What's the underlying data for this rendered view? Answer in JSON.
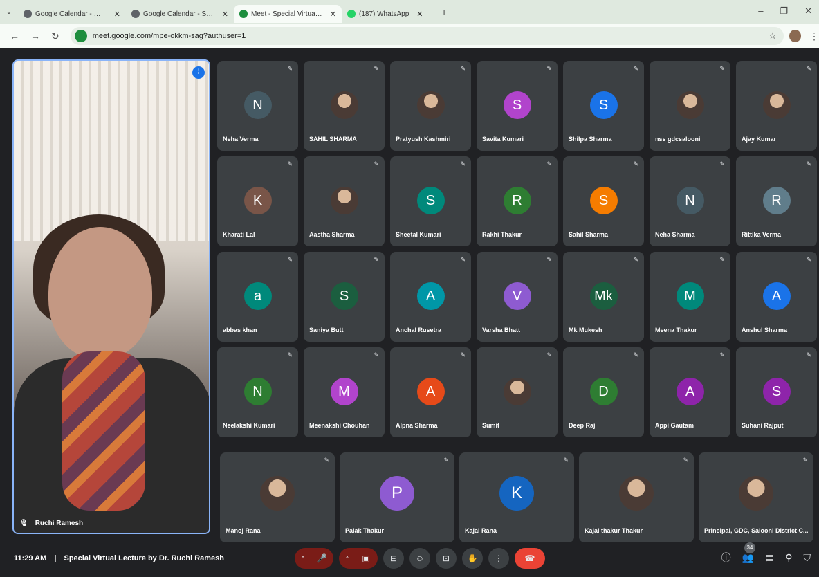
{
  "browser": {
    "tabs": [
      {
        "title": "Google Calendar - Week of De",
        "fav_color": "#5f6368"
      },
      {
        "title": "Google Calendar - Saturday, D",
        "fav_color": "#5f6368"
      },
      {
        "title": "Meet - Special Virtual Lect",
        "fav_color": "#1e8e3e",
        "active": true
      },
      {
        "title": "(187) WhatsApp",
        "fav_color": "#25d366"
      }
    ],
    "url": "meet.google.com/mpe-okkm-sag?authuser=1"
  },
  "presenter": {
    "name": "Ruchi Ramesh"
  },
  "participants": [
    [
      {
        "name": "Neha Verma",
        "initial": "N",
        "color": "#455a64"
      },
      {
        "name": "SAHIL SHARMA",
        "initial": "",
        "photo": true
      },
      {
        "name": "Pratyush Kashmiri",
        "initial": "",
        "photo": true
      },
      {
        "name": "Savita Kumari",
        "initial": "S",
        "color": "#b144cc"
      },
      {
        "name": "Shilpa Sharma",
        "initial": "S",
        "color": "#1a73e8"
      },
      {
        "name": "nss gdcsalooni",
        "initial": "",
        "photo": true
      },
      {
        "name": "Ajay Kumar",
        "initial": "",
        "photo": true
      }
    ],
    [
      {
        "name": "Kharati Lal",
        "initial": "K",
        "color": "#795548"
      },
      {
        "name": "Aastha Sharma",
        "initial": "",
        "photo": true
      },
      {
        "name": "Sheetal Kumari",
        "initial": "S",
        "color": "#00897b"
      },
      {
        "name": "Rakhi Thakur",
        "initial": "R",
        "color": "#2e7d32"
      },
      {
        "name": "Sahil Sharma",
        "initial": "S",
        "color": "#f57c00"
      },
      {
        "name": "Neha Sharma",
        "initial": "N",
        "color": "#455a64"
      },
      {
        "name": "Rittika Verma",
        "initial": "R",
        "color": "#607d8b"
      }
    ],
    [
      {
        "name": "abbas khan",
        "initial": "a",
        "color": "#00897b"
      },
      {
        "name": "Saniya Butt",
        "initial": "S",
        "color": "#1b5e3f"
      },
      {
        "name": "Anchal Rusetra",
        "initial": "A",
        "color": "#0097a7"
      },
      {
        "name": "Varsha Bhatt",
        "initial": "V",
        "color": "#8e5bd1"
      },
      {
        "name": "Mk Mukesh",
        "initial": "Mk",
        "color": "#1b5e3f"
      },
      {
        "name": "Meena Thakur",
        "initial": "M",
        "color": "#00897b"
      },
      {
        "name": "Anshul Sharma",
        "initial": "A",
        "color": "#1a73e8"
      }
    ],
    [
      {
        "name": "Neelakshi Kumari",
        "initial": "N",
        "color": "#2e7d32"
      },
      {
        "name": "Meenakshi Chouhan",
        "initial": "M",
        "color": "#b144cc"
      },
      {
        "name": "Alpna Sharma",
        "initial": "A",
        "color": "#e64a19"
      },
      {
        "name": "Sumit",
        "initial": "",
        "photo": true
      },
      {
        "name": "Deep Raj",
        "initial": "D",
        "color": "#2e7d32"
      },
      {
        "name": "Appi Gautam",
        "initial": "A",
        "color": "#8e24aa"
      },
      {
        "name": "Suhani Rajput",
        "initial": "S",
        "color": "#8e24aa"
      }
    ]
  ],
  "last_row": [
    {
      "name": "Manoj Rana",
      "initial": "",
      "photo": true
    },
    {
      "name": "Palak Thakur",
      "initial": "P",
      "color": "#8e5bd1"
    },
    {
      "name": "Kajal Rana",
      "initial": "K",
      "color": "#1565c0"
    },
    {
      "name": "Kajal thakur Thakur",
      "initial": "",
      "photo": true
    },
    {
      "name": "Principal, GDC, Salooni District C...",
      "initial": "",
      "photo": true
    }
  ],
  "bottom": {
    "time": "11:29 AM",
    "separator": "|",
    "meeting_title": "Special Virtual Lecture by Dr. Ruchi Ramesh",
    "people_count": "34"
  }
}
